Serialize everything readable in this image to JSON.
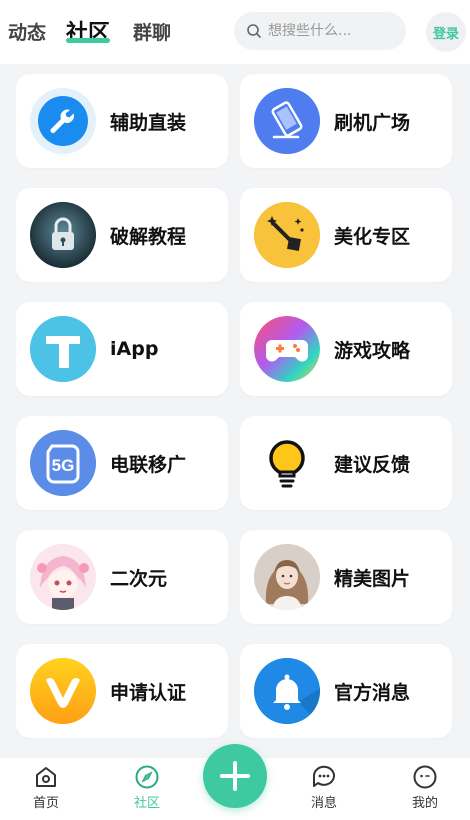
{
  "header": {
    "tabs": [
      {
        "label": "动态",
        "active": false
      },
      {
        "label": "社区",
        "active": true
      },
      {
        "label": "群聊",
        "active": false
      }
    ],
    "search_placeholder": "想搜些什么...",
    "login_label": "登录"
  },
  "grid": {
    "items": [
      {
        "label": "辅助直装",
        "icon": "wrench-icon"
      },
      {
        "label": "刷机广场",
        "icon": "phone-flash-icon"
      },
      {
        "label": "破解教程",
        "icon": "padlock-icon"
      },
      {
        "label": "美化专区",
        "icon": "magic-wand-icon"
      },
      {
        "label": "iApp",
        "icon": "iapp-logo-icon"
      },
      {
        "label": "游戏攻略",
        "icon": "gamepad-icon"
      },
      {
        "label": "电联移广",
        "icon": "5g-icon"
      },
      {
        "label": "建议反馈",
        "icon": "lightbulb-icon"
      },
      {
        "label": "二次元",
        "icon": "anime-avatar-icon"
      },
      {
        "label": "精美图片",
        "icon": "portrait-photo-icon"
      },
      {
        "label": "申请认证",
        "icon": "verified-v-icon"
      },
      {
        "label": "官方消息",
        "icon": "bell-icon"
      }
    ]
  },
  "bottom_nav": {
    "items": [
      {
        "label": "首页",
        "icon": "home-icon",
        "active": false
      },
      {
        "label": "社区",
        "icon": "compass-icon",
        "active": true
      },
      {
        "label": "消息",
        "icon": "chat-icon",
        "active": false
      },
      {
        "label": "我的",
        "icon": "profile-face-icon",
        "active": false
      }
    ],
    "fab_icon": "plus-icon"
  },
  "colors": {
    "accent": "#3ec9a0",
    "background": "#f3f4f6",
    "card": "#ffffff"
  }
}
